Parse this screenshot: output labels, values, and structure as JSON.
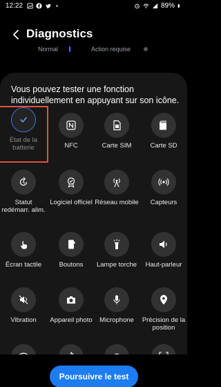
{
  "status_bar": {
    "time": "12:22",
    "battery_percent": "89%",
    "left_icons": [
      "gallery-icon",
      "facebook-icon",
      "twitter-icon",
      "dot-icon"
    ],
    "right_icons": [
      "alarm-icon",
      "wifi-icon",
      "signal-icon",
      "battery-icon"
    ]
  },
  "header": {
    "title": "Diagnostics"
  },
  "bg_summary": {
    "normal": "Normal",
    "action": "Action requise"
  },
  "sheet": {
    "description": "Vous pouvez tester une fonction individuellement en appuyant sur son icône."
  },
  "tiles": [
    {
      "label": "État de la batterie",
      "icon": "check-icon",
      "selected": true
    },
    {
      "label": "NFC",
      "icon": "nfc-icon"
    },
    {
      "label": "Carte SIM",
      "icon": "sim-card-icon"
    },
    {
      "label": "Carte SD",
      "icon": "sd-card-icon"
    },
    {
      "label": "Statut redémarr. alim.",
      "icon": "restart-icon"
    },
    {
      "label": "Logiciel officiel",
      "icon": "badge-icon"
    },
    {
      "label": "Réseau mobile",
      "icon": "cell-tower-icon"
    },
    {
      "label": "Capteurs",
      "icon": "sensors-icon"
    },
    {
      "label": "Écran tactile",
      "icon": "touch-icon"
    },
    {
      "label": "Boutons",
      "icon": "buttons-icon"
    },
    {
      "label": "Lampe torche",
      "icon": "flashlight-icon"
    },
    {
      "label": "Haut-parleur",
      "icon": "speaker-icon"
    },
    {
      "label": "Vibration",
      "icon": "vibration-icon"
    },
    {
      "label": "Appareil photo",
      "icon": "camera-icon"
    },
    {
      "label": "Microphone",
      "icon": "microphone-icon"
    },
    {
      "label": "Précision de la position",
      "icon": "location-icon"
    },
    {
      "label": "",
      "icon": "wifi-icon"
    },
    {
      "label": "",
      "icon": "bluetooth-icon"
    },
    {
      "label": "",
      "icon": "fingerprint-icon"
    },
    {
      "label": "",
      "icon": "face-icon"
    }
  ],
  "cta": {
    "label": "Poursuivre le test"
  },
  "colors": {
    "accent": "#1d7cf2",
    "selection_outline": "#e2523f",
    "sheet_bg": "#171717",
    "icon_bg": "#323232"
  }
}
